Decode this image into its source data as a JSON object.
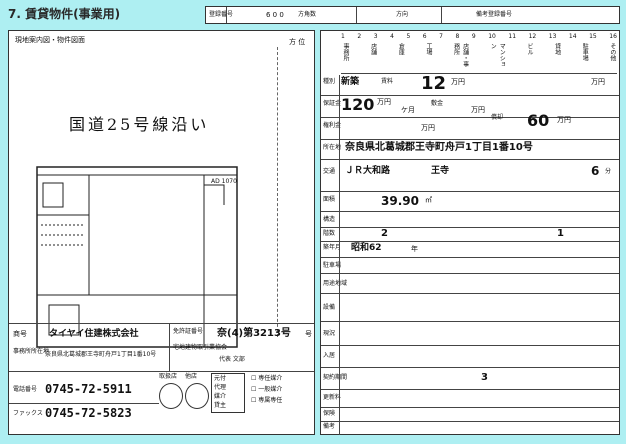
{
  "heading": "7. 賃貸物件(事業用)",
  "top_boxes": [
    {
      "label": "登録番号",
      "value": "",
      "suffix": "方角数"
    },
    {
      "label": "物件番号",
      "value": "6 0 0",
      "suffix": ""
    },
    {
      "label": "予約番号",
      "value": "",
      "suffix": "方向"
    },
    {
      "label": "備考登録番号",
      "value": "",
      "suffix": ""
    }
  ],
  "left": {
    "map_title": "現地案内図・物件図面",
    "compass": "方 位",
    "road_label": "国道25号線沿い",
    "plan_dim": "AD 1070",
    "company_label": "商号",
    "company_name": "タイヤイ住建株式会社",
    "address_label": "事務所所在地",
    "address": "奈良県北葛城郡王寺町舟戸1丁目1番10号",
    "license_label": "免許証番号",
    "license_value": "奈(4)第3213号",
    "license_extra": "号",
    "license_member": "宅地建物取引業協会",
    "manager": "代表 文部",
    "stamp_labels": [
      "取扱店",
      "他店"
    ],
    "tel_label": "電話番号",
    "tel": "0745-72-5911",
    "fax_label": "ファックス",
    "fax": "0745-72-5823",
    "role_items": [
      "元付",
      "代理",
      "媒介",
      "貸主"
    ],
    "checks": [
      "☐ 専任媒介",
      "☐ 一般媒介",
      "☐ 専属専任"
    ]
  },
  "right": {
    "top_numbers": [
      "1",
      "2",
      "3",
      "4",
      "5",
      "6",
      "7",
      "8",
      "9",
      "10",
      "11",
      "12",
      "13",
      "14",
      "15",
      "16"
    ],
    "type_labels": [
      "事務所",
      "店舗",
      "倉庫",
      "工場",
      "店舗・事務所",
      "マンション",
      "ビル",
      "貸地",
      "駐車場",
      "その他"
    ],
    "rows": {
      "kind_label": "種別",
      "kind_value": "新築",
      "rent_label": "賃料",
      "rent_value": "12",
      "rent_unit": "万円",
      "mgmt_unit": "万円",
      "deposit_label": "保証金",
      "deposit_value": "120",
      "deposit_unit": "万円",
      "deposit_months": "ケ月",
      "key_label": "敷金",
      "key_unit": "万円",
      "premium_label": "権利金",
      "premium_unit": "万円",
      "amort_label": "償却",
      "amort_value": "60",
      "amort_unit": "万円",
      "location_label": "所在地",
      "location": "奈良県北葛城郡王寺町舟戸1丁目1番10号",
      "transport_label": "交通",
      "line": "ＪＲ大和路",
      "station": "王寺",
      "walk": "6",
      "walk_unit": "分",
      "area_label": "面積",
      "area_value": "39.90",
      "area_unit": "㎡",
      "struct_label": "構造",
      "floor_label": "階数",
      "floor_value": "2",
      "floor_value2": "1",
      "built_label": "築年月",
      "built_value": "昭和62",
      "built_unit": "年",
      "parking_label": "駐車場",
      "zoning_label": "用途地域",
      "facilities_label": "設備",
      "current_label": "現況",
      "move_label": "入居",
      "contract_label": "契約期間",
      "contract_value": "3",
      "renewal_label": "更新料",
      "insurance_label": "保険",
      "notes_label": "備考"
    }
  }
}
